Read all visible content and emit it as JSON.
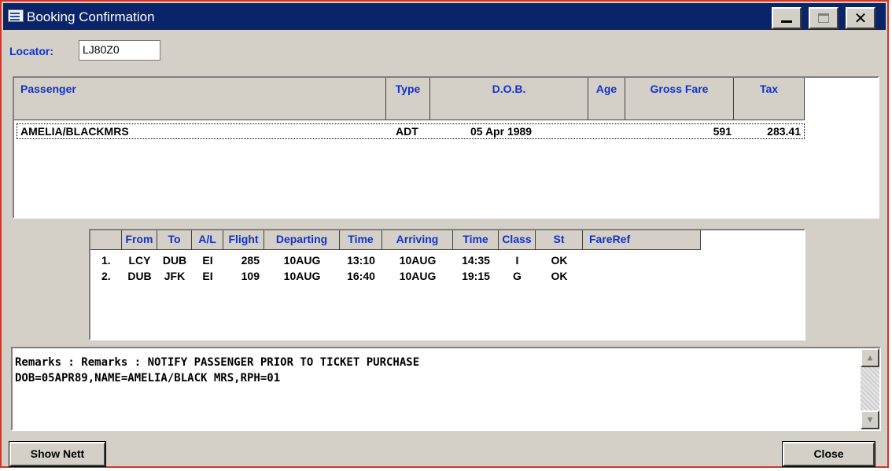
{
  "window": {
    "title": "Booking Confirmation",
    "min_label": "_",
    "max_label": "",
    "close_label": "✕"
  },
  "locator": {
    "label": "Locator:",
    "value": "LJ80Z0"
  },
  "passenger_table": {
    "headers": [
      "Passenger",
      "Type",
      "D.O.B.",
      "Age",
      "Gross Fare",
      "Tax"
    ],
    "rows": [
      {
        "passenger": "AMELIA/BLACKMRS",
        "type": "ADT",
        "dob": "05 Apr 1989",
        "age": "",
        "gross_fare": "591",
        "tax": "283.41"
      }
    ]
  },
  "segments_table": {
    "headers": [
      "",
      "From",
      "To",
      "A/L",
      "Flight",
      "Departing",
      "Time",
      "Arriving",
      "Time",
      "Class",
      "St",
      "FareRef"
    ],
    "rows": [
      {
        "num": "1.",
        "from": "LCY",
        "to": "DUB",
        "al": "EI",
        "flight": "285",
        "departing": "10AUG",
        "dep_time": "13:10",
        "arriving": "10AUG",
        "arr_time": "14:35",
        "class": "I",
        "status": "OK",
        "fareref": ""
      },
      {
        "num": "2.",
        "from": "DUB",
        "to": "JFK",
        "al": "EI",
        "flight": "109",
        "departing": "10AUG",
        "dep_time": "16:40",
        "arriving": "10AUG",
        "arr_time": "19:15",
        "class": "G",
        "status": "OK",
        "fareref": ""
      }
    ]
  },
  "remarks": {
    "line1": "Remarks : Remarks : NOTIFY PASSENGER PRIOR TO TICKET PURCHASE",
    "line2": "DOB=05APR89,NAME=AMELIA/BLACK MRS,RPH=01"
  },
  "buttons": {
    "show_nett": "Show Nett",
    "close": "Close"
  },
  "colors": {
    "titlebar": "#0a246a",
    "header_text": "#1032cc",
    "face": "#d4d0c8",
    "window_border": "#d4352b"
  }
}
